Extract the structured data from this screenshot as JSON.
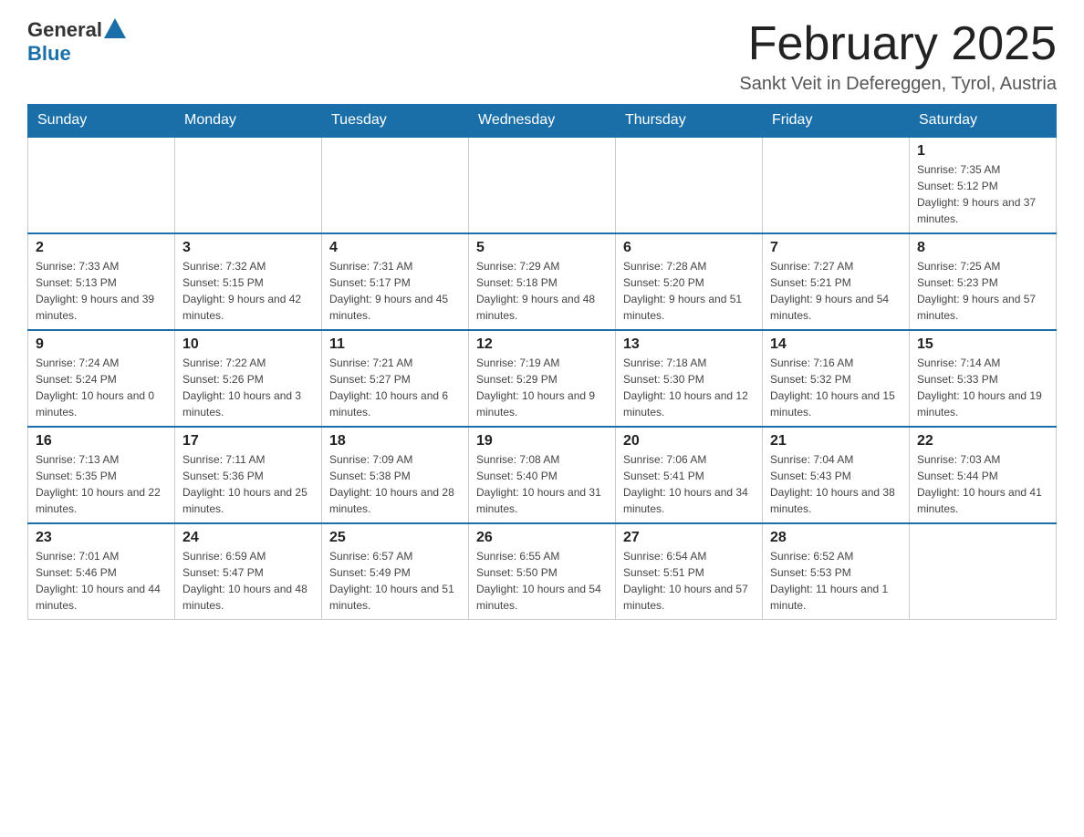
{
  "logo": {
    "text_general": "General",
    "text_blue": "Blue"
  },
  "title": "February 2025",
  "subtitle": "Sankt Veit in Defereggen, Tyrol, Austria",
  "days_of_week": [
    "Sunday",
    "Monday",
    "Tuesday",
    "Wednesday",
    "Thursday",
    "Friday",
    "Saturday"
  ],
  "weeks": [
    [
      {
        "day": "",
        "info": ""
      },
      {
        "day": "",
        "info": ""
      },
      {
        "day": "",
        "info": ""
      },
      {
        "day": "",
        "info": ""
      },
      {
        "day": "",
        "info": ""
      },
      {
        "day": "",
        "info": ""
      },
      {
        "day": "1",
        "info": "Sunrise: 7:35 AM\nSunset: 5:12 PM\nDaylight: 9 hours and 37 minutes."
      }
    ],
    [
      {
        "day": "2",
        "info": "Sunrise: 7:33 AM\nSunset: 5:13 PM\nDaylight: 9 hours and 39 minutes."
      },
      {
        "day": "3",
        "info": "Sunrise: 7:32 AM\nSunset: 5:15 PM\nDaylight: 9 hours and 42 minutes."
      },
      {
        "day": "4",
        "info": "Sunrise: 7:31 AM\nSunset: 5:17 PM\nDaylight: 9 hours and 45 minutes."
      },
      {
        "day": "5",
        "info": "Sunrise: 7:29 AM\nSunset: 5:18 PM\nDaylight: 9 hours and 48 minutes."
      },
      {
        "day": "6",
        "info": "Sunrise: 7:28 AM\nSunset: 5:20 PM\nDaylight: 9 hours and 51 minutes."
      },
      {
        "day": "7",
        "info": "Sunrise: 7:27 AM\nSunset: 5:21 PM\nDaylight: 9 hours and 54 minutes."
      },
      {
        "day": "8",
        "info": "Sunrise: 7:25 AM\nSunset: 5:23 PM\nDaylight: 9 hours and 57 minutes."
      }
    ],
    [
      {
        "day": "9",
        "info": "Sunrise: 7:24 AM\nSunset: 5:24 PM\nDaylight: 10 hours and 0 minutes."
      },
      {
        "day": "10",
        "info": "Sunrise: 7:22 AM\nSunset: 5:26 PM\nDaylight: 10 hours and 3 minutes."
      },
      {
        "day": "11",
        "info": "Sunrise: 7:21 AM\nSunset: 5:27 PM\nDaylight: 10 hours and 6 minutes."
      },
      {
        "day": "12",
        "info": "Sunrise: 7:19 AM\nSunset: 5:29 PM\nDaylight: 10 hours and 9 minutes."
      },
      {
        "day": "13",
        "info": "Sunrise: 7:18 AM\nSunset: 5:30 PM\nDaylight: 10 hours and 12 minutes."
      },
      {
        "day": "14",
        "info": "Sunrise: 7:16 AM\nSunset: 5:32 PM\nDaylight: 10 hours and 15 minutes."
      },
      {
        "day": "15",
        "info": "Sunrise: 7:14 AM\nSunset: 5:33 PM\nDaylight: 10 hours and 19 minutes."
      }
    ],
    [
      {
        "day": "16",
        "info": "Sunrise: 7:13 AM\nSunset: 5:35 PM\nDaylight: 10 hours and 22 minutes."
      },
      {
        "day": "17",
        "info": "Sunrise: 7:11 AM\nSunset: 5:36 PM\nDaylight: 10 hours and 25 minutes."
      },
      {
        "day": "18",
        "info": "Sunrise: 7:09 AM\nSunset: 5:38 PM\nDaylight: 10 hours and 28 minutes."
      },
      {
        "day": "19",
        "info": "Sunrise: 7:08 AM\nSunset: 5:40 PM\nDaylight: 10 hours and 31 minutes."
      },
      {
        "day": "20",
        "info": "Sunrise: 7:06 AM\nSunset: 5:41 PM\nDaylight: 10 hours and 34 minutes."
      },
      {
        "day": "21",
        "info": "Sunrise: 7:04 AM\nSunset: 5:43 PM\nDaylight: 10 hours and 38 minutes."
      },
      {
        "day": "22",
        "info": "Sunrise: 7:03 AM\nSunset: 5:44 PM\nDaylight: 10 hours and 41 minutes."
      }
    ],
    [
      {
        "day": "23",
        "info": "Sunrise: 7:01 AM\nSunset: 5:46 PM\nDaylight: 10 hours and 44 minutes."
      },
      {
        "day": "24",
        "info": "Sunrise: 6:59 AM\nSunset: 5:47 PM\nDaylight: 10 hours and 48 minutes."
      },
      {
        "day": "25",
        "info": "Sunrise: 6:57 AM\nSunset: 5:49 PM\nDaylight: 10 hours and 51 minutes."
      },
      {
        "day": "26",
        "info": "Sunrise: 6:55 AM\nSunset: 5:50 PM\nDaylight: 10 hours and 54 minutes."
      },
      {
        "day": "27",
        "info": "Sunrise: 6:54 AM\nSunset: 5:51 PM\nDaylight: 10 hours and 57 minutes."
      },
      {
        "day": "28",
        "info": "Sunrise: 6:52 AM\nSunset: 5:53 PM\nDaylight: 11 hours and 1 minute."
      },
      {
        "day": "",
        "info": ""
      }
    ]
  ]
}
